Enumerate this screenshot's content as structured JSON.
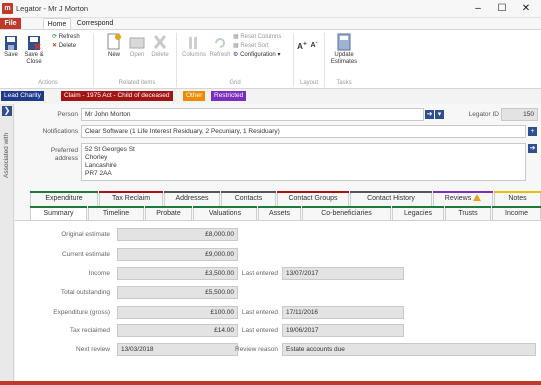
{
  "window": {
    "app_name": "Legator",
    "title": "Legator - Mr J Morton",
    "icon_letter": "m",
    "controls": {
      "minimize": "–",
      "maximize": "☐",
      "close": "✕"
    }
  },
  "menu": {
    "file": "File",
    "tabs": [
      "Home",
      "Correspond"
    ]
  },
  "ribbon": {
    "actions": {
      "save": "Save",
      "save_close": "Save & Close",
      "refresh": "Refresh",
      "delete": "Delete",
      "group": "Actions"
    },
    "related_items": {
      "new": "New",
      "open": "Open",
      "delete": "Delete",
      "group": "Related items"
    },
    "grid": {
      "columns": "Columns",
      "refresh": "Refresh",
      "reset_columns": "Reset Columns",
      "reset_sort": "Reset Sort",
      "configuration": "Configuration",
      "group": "Grid"
    },
    "layout": {
      "group": "Layout"
    },
    "tasks": {
      "update_estimates": "Update Estimates",
      "group": "Tasks"
    }
  },
  "badges": [
    {
      "label": "Lead Charity",
      "color": "#1f3a8a"
    },
    {
      "label": "Claim - 1975 Act - Child of deceased",
      "color": "#a31515"
    },
    {
      "label": "Other",
      "color": "#f08a00"
    },
    {
      "label": "Restricted",
      "color": "#7b2fbe"
    }
  ],
  "rail": {
    "label": "Associated with",
    "arrow": "❯"
  },
  "person": {
    "label": "Person",
    "value": "Mr John Morton",
    "legator_id_label": "Legator ID",
    "legator_id": "150"
  },
  "notifications": {
    "label": "Notifications",
    "value": "Clear Software (1 Life Interest Residuary, 2 Pecuniary, 1 Residuary)"
  },
  "address": {
    "label_line1": "Preferred",
    "label_line2": "address",
    "lines": [
      "52 St Georges St",
      "Chorley",
      "Lancashire",
      "PR7 2AA"
    ]
  },
  "tabs_row1": [
    {
      "label": "Expenditure",
      "color": "#1e7a3a",
      "warn": false
    },
    {
      "label": "Tax Reclaim",
      "color": "#a31515",
      "warn": false
    },
    {
      "label": "Addresses",
      "color": "#555555",
      "warn": false
    },
    {
      "label": "Contacts",
      "color": "#555555",
      "warn": false
    },
    {
      "label": "Contact Groups",
      "color": "#a31515",
      "warn": false
    },
    {
      "label": "Contact History",
      "color": "#555555",
      "warn": false
    },
    {
      "label": "Reviews",
      "color": "#7b2fbe",
      "warn": true
    },
    {
      "label": "Notes",
      "color": "#e0c400",
      "warn": false
    }
  ],
  "tabs_row2": [
    {
      "label": "Summary",
      "color": "#1e7a3a",
      "active": true
    },
    {
      "label": "Timeline",
      "color": "#1e7a3a",
      "active": false
    },
    {
      "label": "Probate",
      "color": "#1e7a3a",
      "active": false
    },
    {
      "label": "Valuations",
      "color": "#1e7a3a",
      "active": false
    },
    {
      "label": "Assets",
      "color": "#1e7a3a",
      "active": false
    },
    {
      "label": "Co-beneficiaries",
      "color": "#1e7a3a",
      "active": false
    },
    {
      "label": "Legacies",
      "color": "#1e7a3a",
      "active": false
    },
    {
      "label": "Trusts",
      "color": "#1e7a3a",
      "active": false
    },
    {
      "label": "Income",
      "color": "#1e7a3a",
      "active": false
    }
  ],
  "summary": {
    "original_estimate": {
      "label": "Original estimate",
      "value": "£8,000.00"
    },
    "current_estimate": {
      "label": "Current estimate",
      "value": "£9,000.00"
    },
    "income": {
      "label": "Income",
      "value": "£3,500.00",
      "last_entered_label": "Last entered",
      "last_entered": "13/07/2017"
    },
    "total_outstanding": {
      "label": "Total outstanding",
      "value": "£5,500.00"
    },
    "expenditure": {
      "label": "Expenditure (gross)",
      "value": "£100.00",
      "last_entered_label": "Last entered",
      "last_entered": "17/11/2016"
    },
    "tax_reclaimed": {
      "label": "Tax reclaimed",
      "value": "£14.00",
      "last_entered_label": "Last entered",
      "last_entered": "19/06/2017"
    },
    "next_review": {
      "label": "Next review",
      "value": "13/03/2018",
      "review_reason_label": "Review reason",
      "review_reason": "Estate accounts due"
    }
  }
}
